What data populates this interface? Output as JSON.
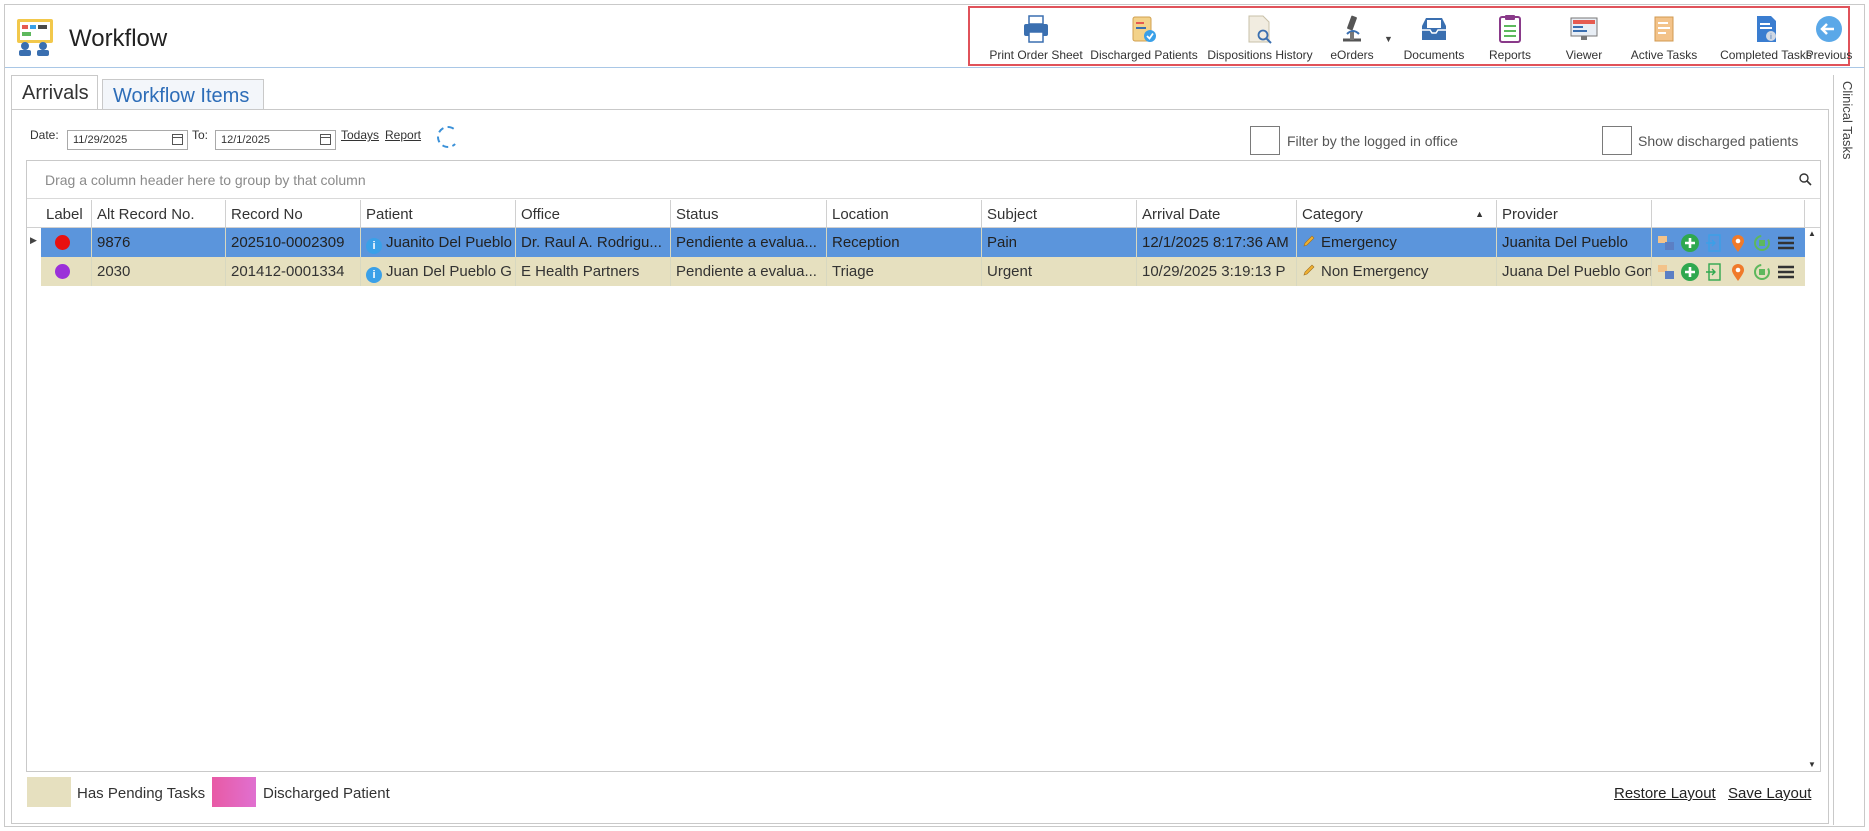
{
  "app": {
    "title": "Workflow"
  },
  "toolbar": {
    "items": [
      {
        "label": "Print Order Sheet",
        "icon": "printer-icon"
      },
      {
        "label": "Discharged Patients",
        "icon": "clipboard-check-icon"
      },
      {
        "label": "Dispositions History",
        "icon": "document-search-icon"
      },
      {
        "label": "eOrders",
        "icon": "microscope-icon"
      },
      {
        "label": "Documents",
        "icon": "inbox-tray-icon"
      },
      {
        "label": "Reports",
        "icon": "clipboard-list-icon"
      },
      {
        "label": "Viewer",
        "icon": "monitor-icon"
      },
      {
        "label": "Active Tasks",
        "icon": "tasks-icon"
      },
      {
        "label": "Completed Tasks",
        "icon": "completed-document-icon"
      },
      {
        "label": "Previous",
        "icon": "arrow-left-circle-icon"
      }
    ]
  },
  "tabs": [
    {
      "label": "Arrivals",
      "active": false
    },
    {
      "label": "Workflow Items",
      "active": true
    }
  ],
  "side_panel": {
    "label": "Clinical Tasks"
  },
  "filters": {
    "date_label": "Date:",
    "date_from": "11/29/2025",
    "to_label": "To:",
    "date_to": "12/1/2025",
    "todays_link": "Todays",
    "report_link": "Report",
    "filter_office_label": "Filter by the logged in office",
    "show_discharged_label": "Show discharged patients"
  },
  "grid": {
    "group_panel_text": "Drag a column header here to group by that column",
    "columns": [
      "Label",
      "Alt Record No.",
      "Record No",
      "Patient",
      "Office",
      "Status",
      "Location",
      "Subject",
      "Arrival Date",
      "Category",
      "Provider"
    ],
    "sorted_column": "Category",
    "rows": [
      {
        "label_color": "#e81010",
        "alt_record_no": "9876",
        "record_no": "202510-0002309",
        "patient": "Juanito Del Pueblo",
        "office": "Dr. Raul A. Rodrigu...",
        "status": "Pendiente a evalua...",
        "location": "Reception",
        "subject": "Pain",
        "arrival_date": "12/1/2025 8:17:36 AM",
        "category": "Emergency",
        "provider": "Juanita Del Pueblo",
        "selected": true
      },
      {
        "label_color": "#9b30d9",
        "alt_record_no": "2030",
        "record_no": "201412-0001334",
        "patient": "Juan Del Pueblo G",
        "office": "E Health Partners",
        "status": "Pendiente a evalua...",
        "location": "Triage",
        "subject": "Urgent",
        "arrival_date": "10/29/2025 3:19:13 P",
        "category": "Non Emergency",
        "provider": "Juana Del Pueblo Gon",
        "selected": false
      }
    ]
  },
  "legend": {
    "pending_label": "Has Pending Tasks",
    "pending_color": "#e6e0bf",
    "discharged_label": "Discharged Patient",
    "discharged_color": "#e85aa5"
  },
  "footer": {
    "restore_layout": "Restore Layout",
    "save_layout": "Save Layout"
  }
}
